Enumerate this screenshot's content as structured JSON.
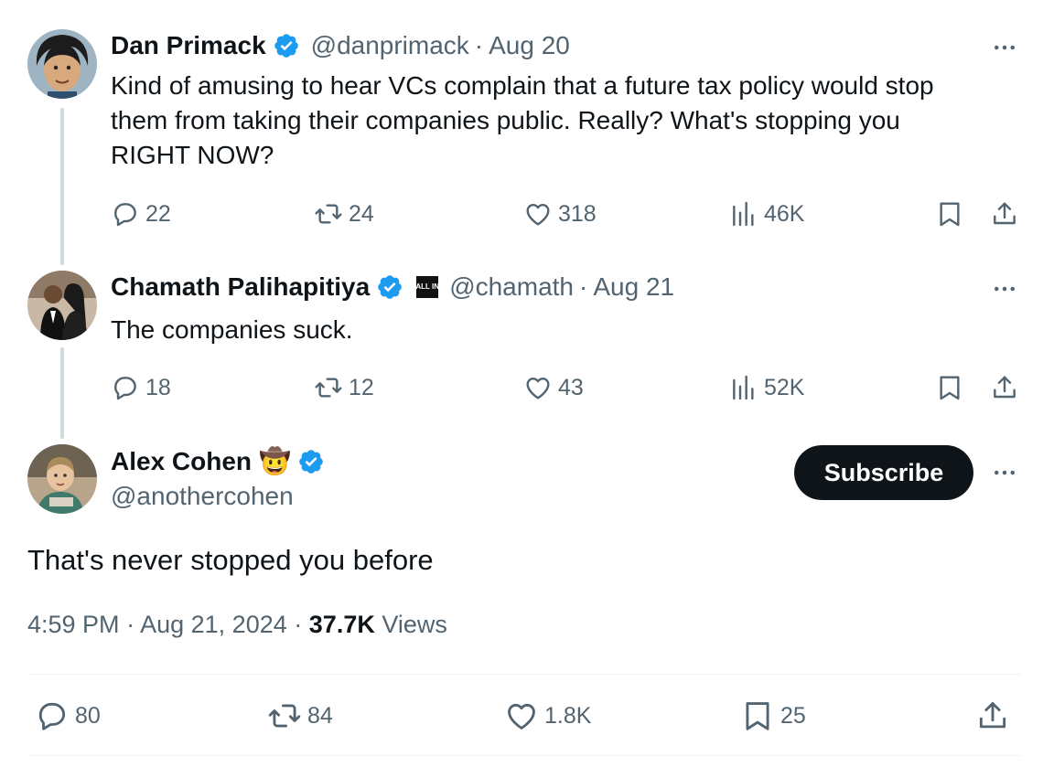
{
  "colors": {
    "accent": "#1d9bf0",
    "text": "#0f1419",
    "muted": "#536471",
    "thread_line": "#cfd9de"
  },
  "tweets": [
    {
      "name": "Dan Primack",
      "handle": "@danprimack",
      "separator": "·",
      "date": "Aug 20",
      "text_lines": [
        "Kind of amusing to hear VCs complain that a future tax policy would stop",
        "them from taking their companies public. Really? What's stopping you",
        "RIGHT NOW?"
      ],
      "replies": "22",
      "reposts": "24",
      "likes": "318",
      "views": "46K"
    },
    {
      "name": "Chamath Palihapitiya",
      "badge": "ALL IN",
      "handle": "@chamath",
      "separator": "·",
      "date": "Aug 21",
      "text": "The companies suck.",
      "replies": "18",
      "reposts": "12",
      "likes": "43",
      "views": "52K"
    }
  ],
  "main_tweet": {
    "name": "Alex Cohen",
    "emoji": "🤠",
    "handle": "@anothercohen",
    "subscribe_label": "Subscribe",
    "text": "That's never stopped you before",
    "time": "4:59 PM",
    "separator": "·",
    "date": "Aug 21, 2024",
    "views_count": "37.7K",
    "views_label": "Views",
    "replies": "80",
    "reposts": "84",
    "likes": "1.8K",
    "bookmarks": "25"
  },
  "icons": {
    "verified": "verified-badge-icon",
    "more": "more-icon",
    "reply": "reply-icon",
    "repost": "repost-icon",
    "like": "like-icon",
    "views": "views-icon",
    "bookmark": "bookmark-icon",
    "share": "share-icon"
  }
}
